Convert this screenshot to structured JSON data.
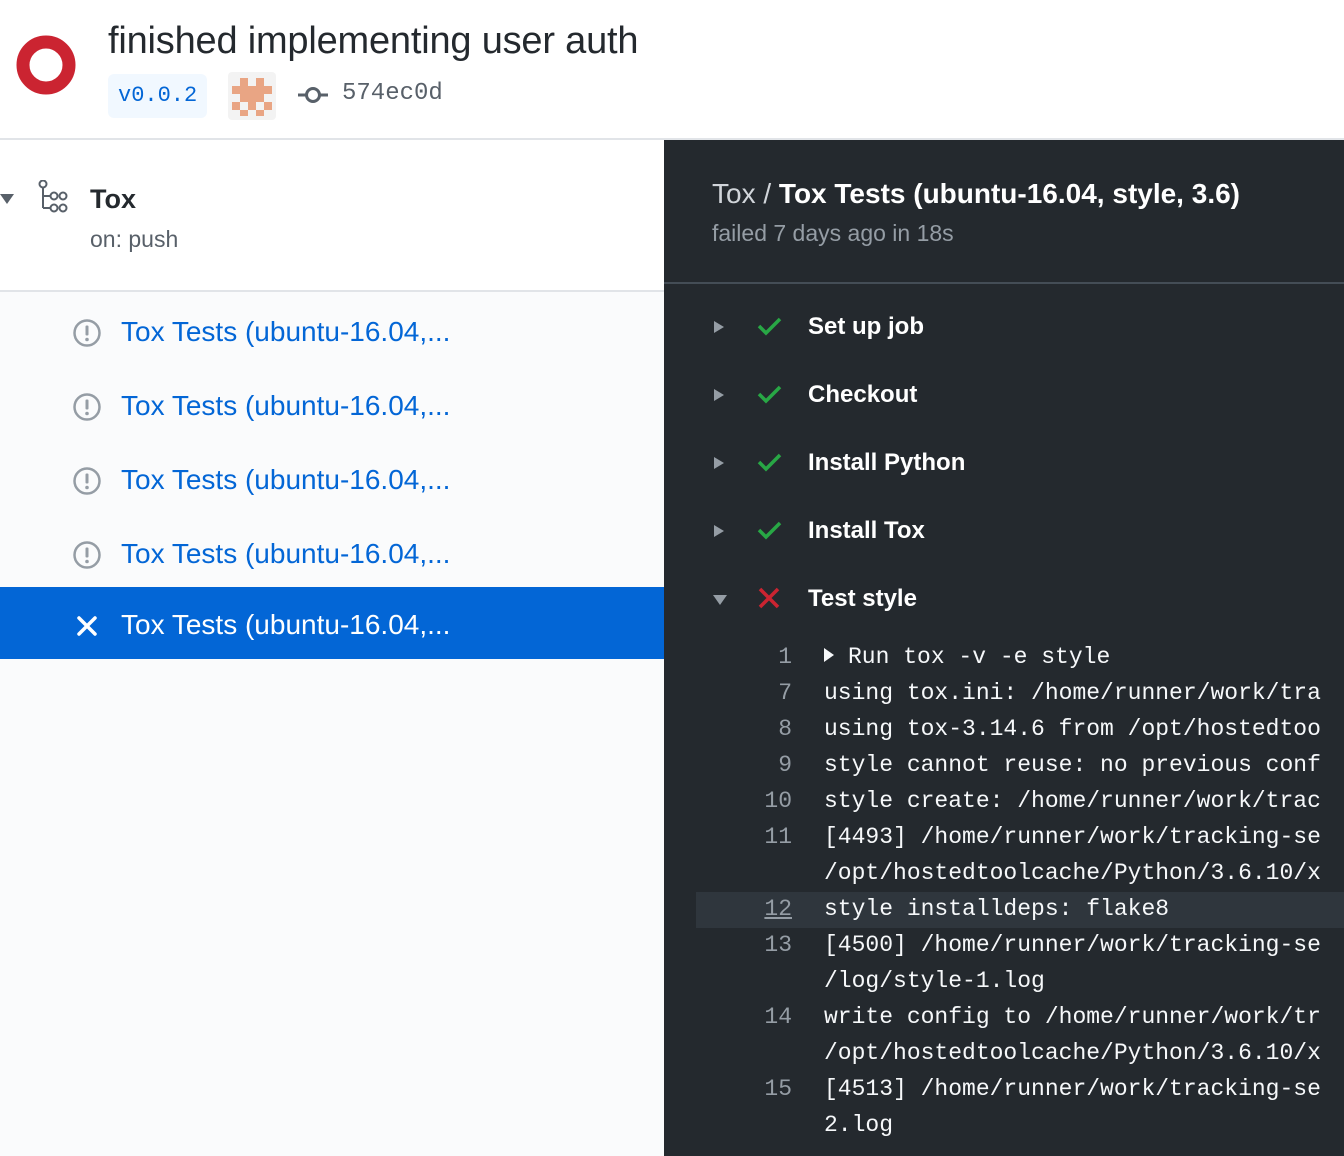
{
  "header": {
    "title": "finished implementing user auth",
    "tag": "v0.0.2",
    "commit_sha": "574ec0d",
    "status": "failure",
    "status_color": "#cb2431"
  },
  "workflow": {
    "name": "Tox",
    "trigger": "on: push",
    "jobs": [
      {
        "label": "Tox Tests (ubuntu-16.04,...",
        "status": "cancelled",
        "icon": "alert-circle-icon",
        "selected": false
      },
      {
        "label": "Tox Tests (ubuntu-16.04,...",
        "status": "cancelled",
        "icon": "alert-circle-icon",
        "selected": false
      },
      {
        "label": "Tox Tests (ubuntu-16.04,...",
        "status": "cancelled",
        "icon": "alert-circle-icon",
        "selected": false
      },
      {
        "label": "Tox Tests (ubuntu-16.04,...",
        "status": "cancelled",
        "icon": "alert-circle-icon",
        "selected": false
      },
      {
        "label": "Tox Tests (ubuntu-16.04,...",
        "status": "failed",
        "icon": "x-icon",
        "selected": true
      }
    ]
  },
  "log": {
    "workflow": "Tox",
    "separator": "/",
    "job_title": "Tox Tests (ubuntu-16.04, style, 3.6)",
    "meta": "failed 7 days ago in 18s",
    "steps": [
      {
        "label": "Set up job",
        "status": "success",
        "expanded": false
      },
      {
        "label": "Checkout",
        "status": "success",
        "expanded": false
      },
      {
        "label": "Install Python",
        "status": "success",
        "expanded": false
      },
      {
        "label": "Install Tox",
        "status": "success",
        "expanded": false
      },
      {
        "label": "Test style",
        "status": "failure",
        "expanded": true
      }
    ],
    "lines": [
      {
        "n": "1",
        "text": "Run tox -v -e style",
        "collapsible": true
      },
      {
        "n": "7",
        "text": "using tox.ini: /home/runner/work/tra"
      },
      {
        "n": "8",
        "text": "using tox-3.14.6 from /opt/hostedtoo"
      },
      {
        "n": "9",
        "text": "style cannot reuse: no previous conf"
      },
      {
        "n": "10",
        "text": "style create: /home/runner/work/trac"
      },
      {
        "n": "11",
        "text": "[4493] /home/runner/work/tracking-se"
      },
      {
        "n": "",
        "text": "/opt/hostedtoolcache/Python/3.6.10/x"
      },
      {
        "n": "12",
        "text": "style installdeps: flake8",
        "highlighted": true
      },
      {
        "n": "13",
        "text": "[4500] /home/runner/work/tracking-se"
      },
      {
        "n": "",
        "text": "/log/style-1.log"
      },
      {
        "n": "14",
        "text": "write config to /home/runner/work/tr"
      },
      {
        "n": "",
        "text": "/opt/hostedtoolcache/Python/3.6.10/x"
      },
      {
        "n": "15",
        "text": "[4513] /home/runner/work/tracking-se"
      },
      {
        "n": "",
        "text": "2.log"
      }
    ]
  },
  "colors": {
    "link": "#0366d6",
    "success": "#28a745",
    "failure": "#cb2431",
    "log_bg": "#24292e"
  }
}
